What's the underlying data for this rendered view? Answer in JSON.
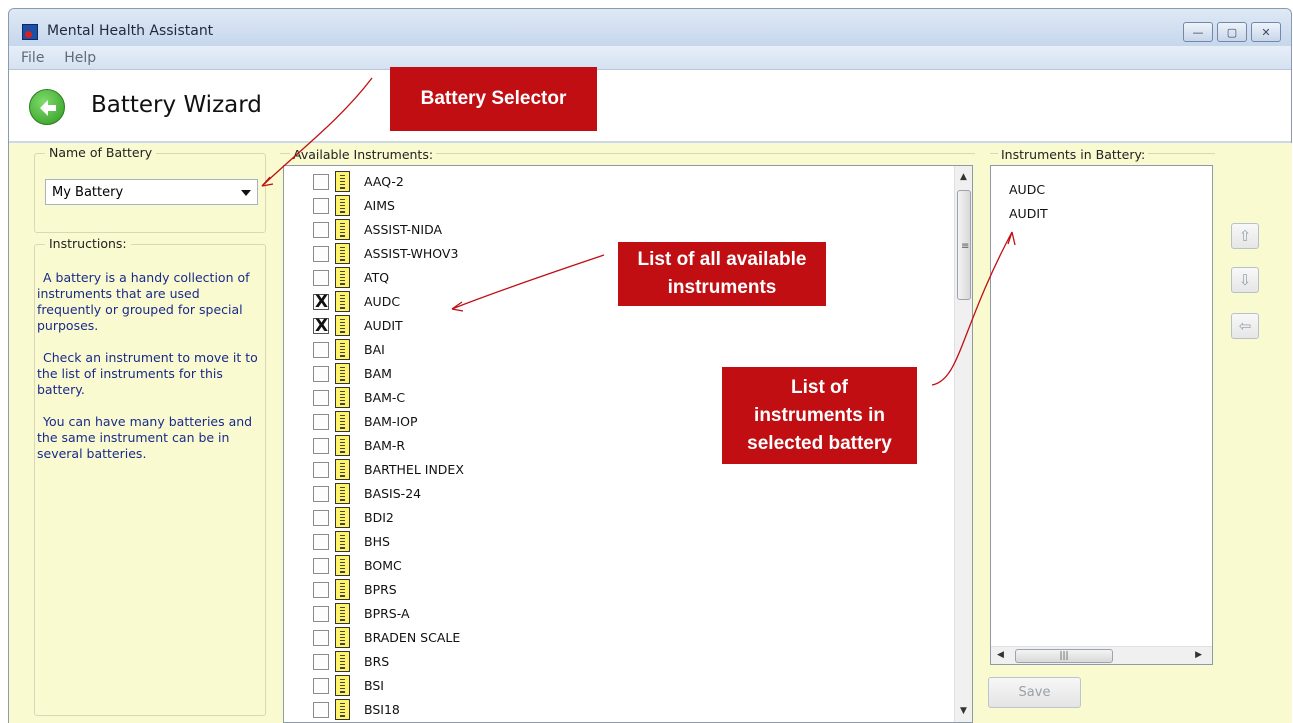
{
  "window": {
    "title": "Mental Health Assistant",
    "buttons": [
      "—",
      "▢",
      "✕"
    ]
  },
  "menu": {
    "items": [
      "File",
      "Help"
    ]
  },
  "header": {
    "title": "Battery Wizard"
  },
  "battery_name": {
    "legend": "Name of Battery",
    "selected": "My Battery"
  },
  "instructions": {
    "legend": "Instructions:",
    "paragraphs": [
      "A battery is a handy collection of instruments that are used frequently or grouped for special purposes.",
      "Check an instrument to move it to the list of instruments for this battery.",
      "You can have many batteries and the same instrument can be in several batteries."
    ]
  },
  "available": {
    "legend": "Available Instruments:",
    "items": [
      {
        "label": "AAQ-2",
        "checked": false
      },
      {
        "label": "AIMS",
        "checked": false
      },
      {
        "label": "ASSIST-NIDA",
        "checked": false
      },
      {
        "label": "ASSIST-WHOV3",
        "checked": false
      },
      {
        "label": "ATQ",
        "checked": false
      },
      {
        "label": "AUDC",
        "checked": true
      },
      {
        "label": "AUDIT",
        "checked": true
      },
      {
        "label": "BAI",
        "checked": false
      },
      {
        "label": "BAM",
        "checked": false
      },
      {
        "label": "BAM-C",
        "checked": false
      },
      {
        "label": "BAM-IOP",
        "checked": false
      },
      {
        "label": "BAM-R",
        "checked": false
      },
      {
        "label": "BARTHEL INDEX",
        "checked": false
      },
      {
        "label": "BASIS-24",
        "checked": false
      },
      {
        "label": "BDI2",
        "checked": false
      },
      {
        "label": "BHS",
        "checked": false
      },
      {
        "label": "BOMC",
        "checked": false
      },
      {
        "label": "BPRS",
        "checked": false
      },
      {
        "label": "BPRS-A",
        "checked": false
      },
      {
        "label": "BRADEN SCALE",
        "checked": false
      },
      {
        "label": "BRS",
        "checked": false
      },
      {
        "label": "BSI",
        "checked": false
      },
      {
        "label": "BSI18",
        "checked": false
      }
    ]
  },
  "battery": {
    "legend": "Instruments in Battery:",
    "items": [
      "AUDC",
      "AUDIT"
    ]
  },
  "buttons": {
    "move_up": "⇧",
    "move_down": "⇩",
    "remove": "⇦",
    "save": "Save"
  },
  "callouts": {
    "selector": "Battery Selector",
    "available_line1": "List of all available",
    "available_line2": "instruments",
    "battery_line1": "List of",
    "battery_line2": "instruments in",
    "battery_line3": "selected battery"
  },
  "colors": {
    "callout": "#c00e12",
    "panel_bg": "#fafad0",
    "instructions_text": "#1a2a8c"
  }
}
